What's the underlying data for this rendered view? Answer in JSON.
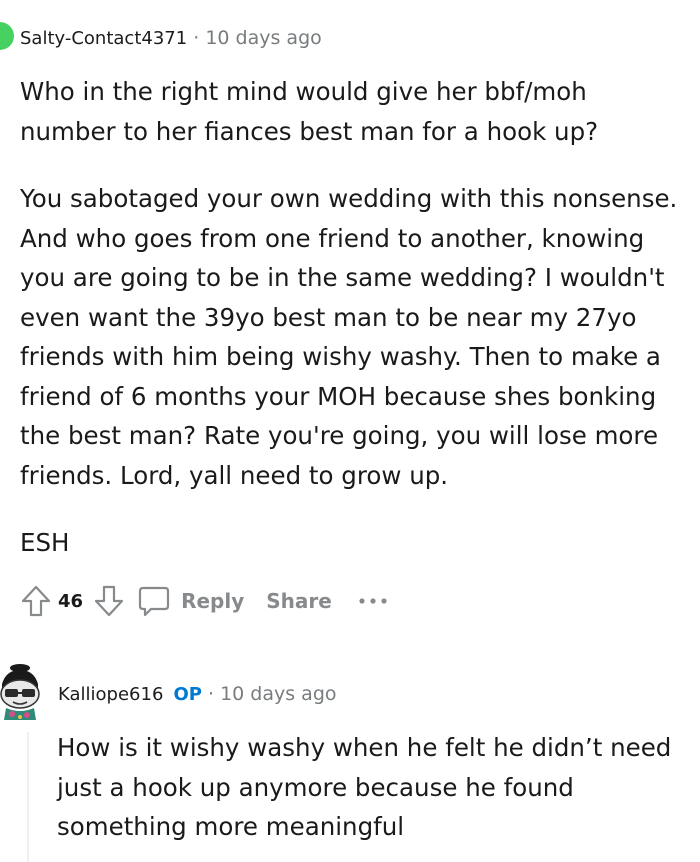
{
  "comment": {
    "username": "Salty-Contact4371",
    "separator": "·",
    "timestamp": "10 days ago",
    "paragraphs": [
      "Who in the right mind would give her bbf/moh number to her fiances best man for a hook up?",
      "You sabotaged your own wedding with this nonsense. And who goes from one friend to another, knowing you are going to be in the same wedding? I wouldn't even want the 39yo best man to be near my 27yo friends with him being wishy washy. Then to make a friend of 6 months your MOH because shes bonking the best man? Rate you're going, you will lose more friends. Lord, yall need to grow up.",
      "ESH"
    ],
    "actions": {
      "score": "46",
      "reply_label": "Reply",
      "share_label": "Share",
      "more_label": "···"
    },
    "avatar_color": "#46d160"
  },
  "reply": {
    "username": "Kalliope616",
    "op_badge": "OP",
    "separator": "·",
    "timestamp": "10 days ago",
    "body": "How is it wishy washy when he felt he didn’t need just a hook up anymore because he found something more meaningful"
  },
  "colors": {
    "meta_gray": "#787c7e",
    "action_gray": "#878a8c",
    "op_blue": "#0079d3",
    "text": "#1a1a1b"
  },
  "icons": {
    "upvote": "upvote-arrow-icon",
    "downvote": "downvote-arrow-icon",
    "reply": "speech-bubble-icon",
    "more": "ellipsis-icon"
  }
}
